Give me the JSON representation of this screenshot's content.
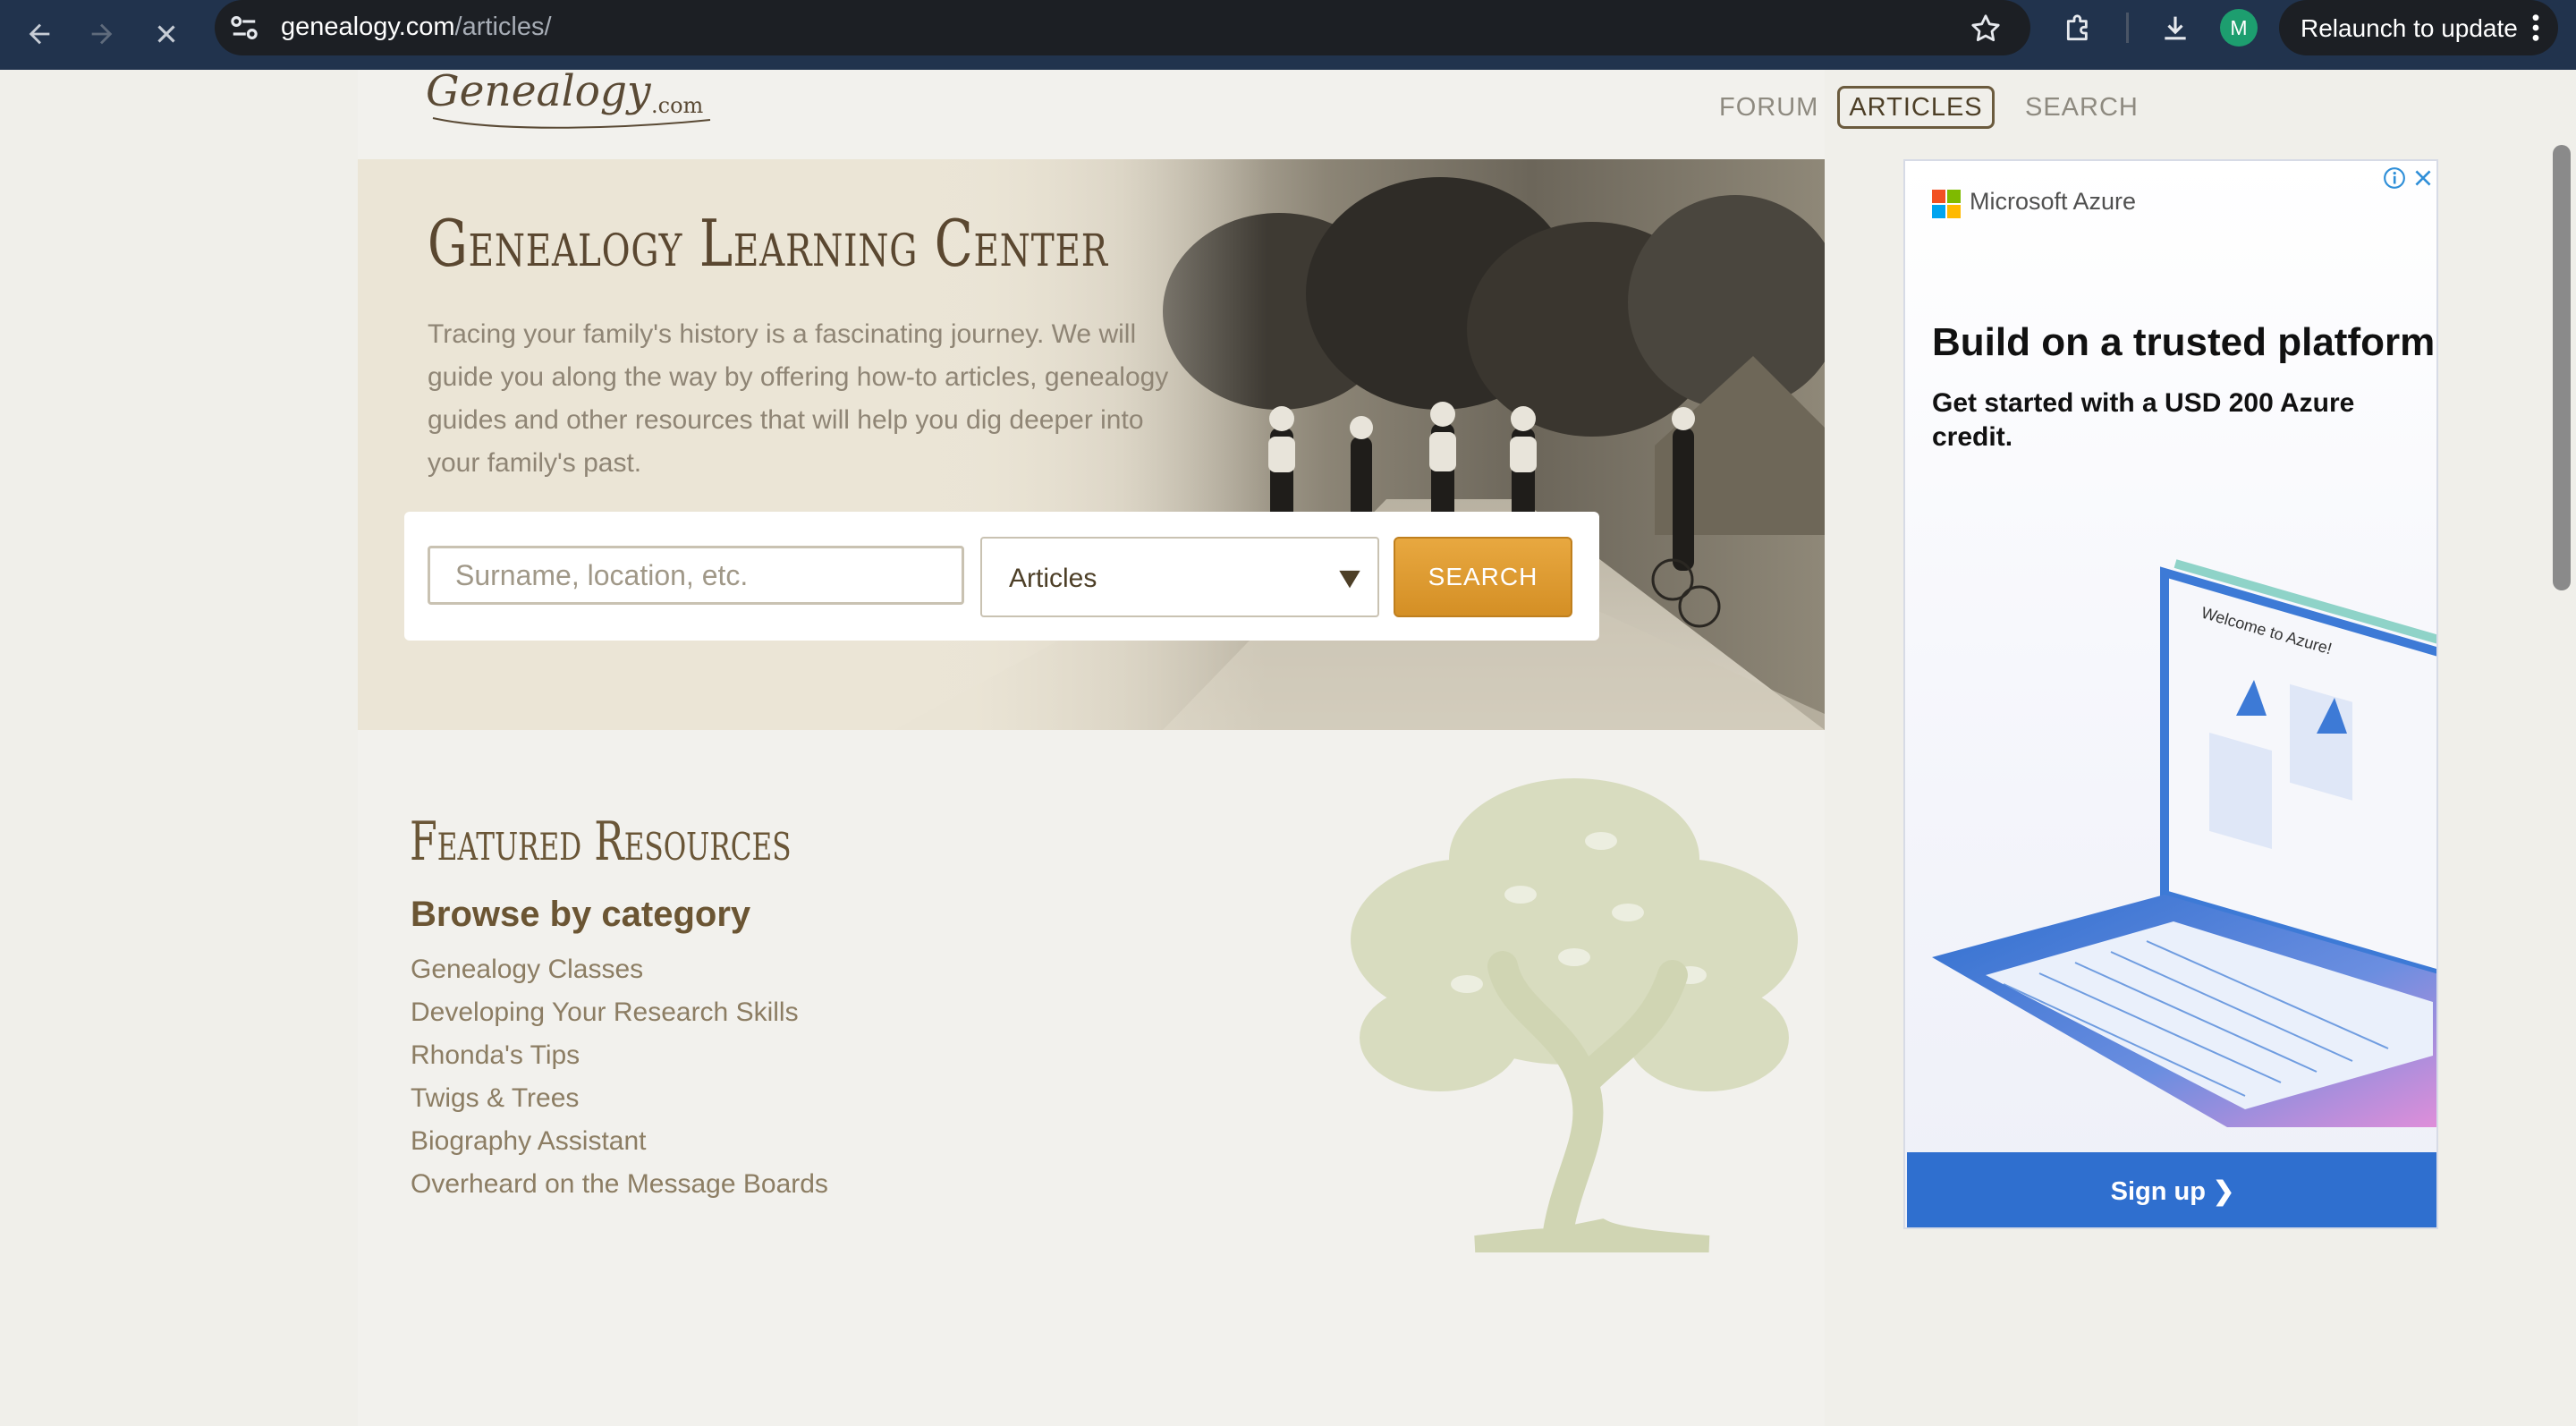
{
  "browser": {
    "url_host": "genealogy.com",
    "url_path": "/articles/",
    "relaunch_label": "Relaunch to update",
    "profile_initial": "M"
  },
  "site": {
    "logo_text": "Genealogy",
    "logo_suffix": ".com",
    "nav": {
      "forum": "FORUM",
      "articles": "ARTICLES",
      "search": "SEARCH"
    }
  },
  "hero": {
    "title": "Genealogy Learning Center",
    "description": "Tracing your family's history is a fascinating journey. We will guide you along the way by offering how-to articles, genealogy guides and other resources that will help you dig deeper into your family's past.",
    "search_placeholder": "Surname, location, etc.",
    "select_value": "Articles",
    "search_button": "SEARCH"
  },
  "featured": {
    "title": "Featured Resources",
    "browse_heading": "Browse by category",
    "categories": [
      "Genealogy Classes",
      "Developing Your Research Skills",
      "Rhonda's Tips",
      "Twigs & Trees",
      "Biography Assistant",
      "Overheard on the Message Boards"
    ]
  },
  "ad": {
    "brand": "Microsoft Azure",
    "headline": "Build on a trusted platform",
    "subtext": "Get started with a USD 200 Azure credit.",
    "screen_text": "Welcome to Azure!",
    "cta": "Sign up ❯"
  },
  "colors": {
    "chrome_bg": "#21334d",
    "accent_button": "#d48f25",
    "heading_brown": "#5a4730",
    "ad_blue": "#2f6fcf"
  }
}
